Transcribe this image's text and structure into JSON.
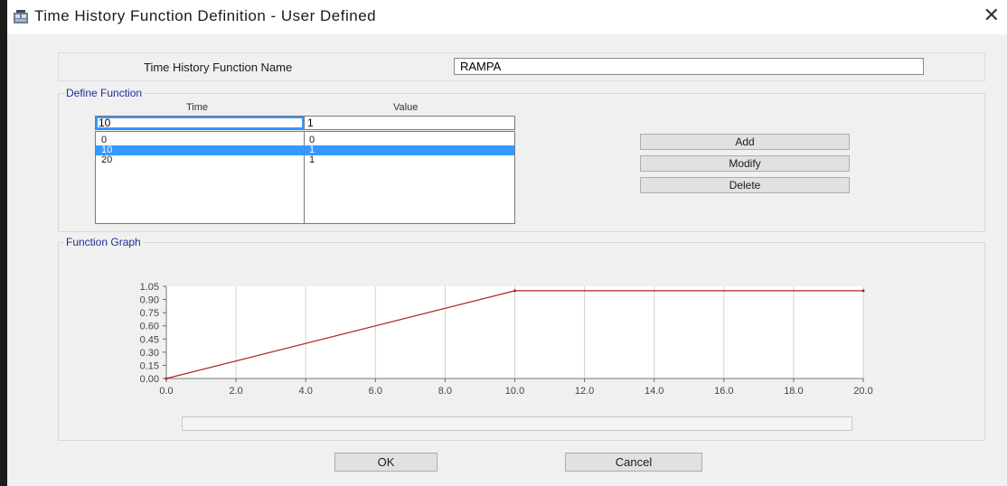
{
  "window": {
    "title": "Time History Function Definition  - User Defined",
    "close_glyph": "✕"
  },
  "name_section": {
    "label": "Time History Function Name",
    "value": "RAMPA"
  },
  "define_function": {
    "legend": "Define Function",
    "time_header": "Time",
    "value_header": "Value",
    "edit_time": "10",
    "edit_value": "1",
    "rows": [
      {
        "time": "0",
        "value": "0",
        "selected": false
      },
      {
        "time": "10",
        "value": "1",
        "selected": true
      },
      {
        "time": "20",
        "value": "1",
        "selected": false
      }
    ],
    "buttons": {
      "add": "Add",
      "modify": "Modify",
      "delete": "Delete"
    }
  },
  "function_graph": {
    "legend": "Function Graph"
  },
  "chart_data": {
    "type": "line",
    "title": "",
    "xlabel": "",
    "ylabel": "",
    "x_ticks": [
      "0.0",
      "2.0",
      "4.0",
      "6.0",
      "8.0",
      "10.0",
      "12.0",
      "14.0",
      "16.0",
      "18.0",
      "20.0"
    ],
    "y_ticks": [
      "0.00",
      "0.15",
      "0.30",
      "0.45",
      "0.60",
      "0.75",
      "0.90",
      "1.05"
    ],
    "xlim": [
      0,
      20
    ],
    "ylim": [
      0,
      1.05
    ],
    "grid": "vertical",
    "line_color": "#b22222",
    "series": [
      {
        "x": [
          0,
          10,
          20
        ],
        "y": [
          0,
          1,
          1
        ]
      }
    ]
  },
  "footer": {
    "ok": "OK",
    "cancel": "Cancel"
  }
}
